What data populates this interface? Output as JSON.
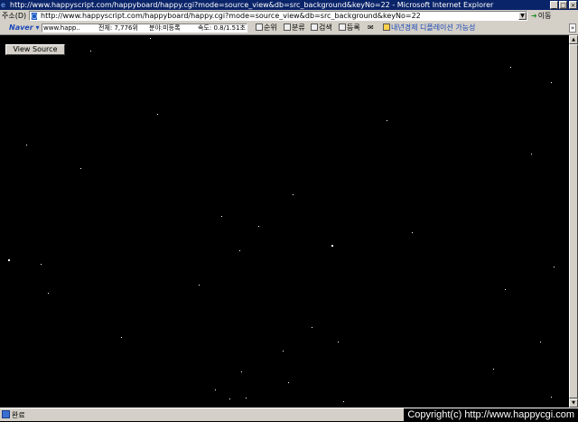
{
  "window": {
    "title": "http://www.happyscript.com/happyboard/happy.cgi?mode=source_view&db=src_background&keyNo=22 - Microsoft Internet Explorer",
    "min_label": "_",
    "max_label": "□",
    "close_label": "×"
  },
  "address_bar": {
    "label": "주소(D)",
    "url": "http://www.happyscript.com/happyboard/happy.cgi?mode=source_view&db=src_background&keyNo=22",
    "dropdown_label": "▼",
    "go_label": "이동"
  },
  "toolbar": {
    "naver_label": "Naver",
    "naver_menu_arrow": "▾",
    "search_value": "www.happ..",
    "total_label": "전체: 7,776위",
    "category_label": "분야:미등록",
    "speed_label": "속도: 0.8/1.51초",
    "rank_label": "순위",
    "classify_label": "분류",
    "search_label": "검색",
    "register_label": "등록",
    "mail_label": "✉",
    "promo_label": "내년경제 디플레이션 가능성",
    "grip_label": "»"
  },
  "content": {
    "view_source_label": "View Source"
  },
  "scrollbar": {
    "up_label": "▲",
    "down_label": "▼"
  },
  "status": {
    "text": "완료",
    "copyright": "Copyright(c) http://www.happycgi.com"
  }
}
